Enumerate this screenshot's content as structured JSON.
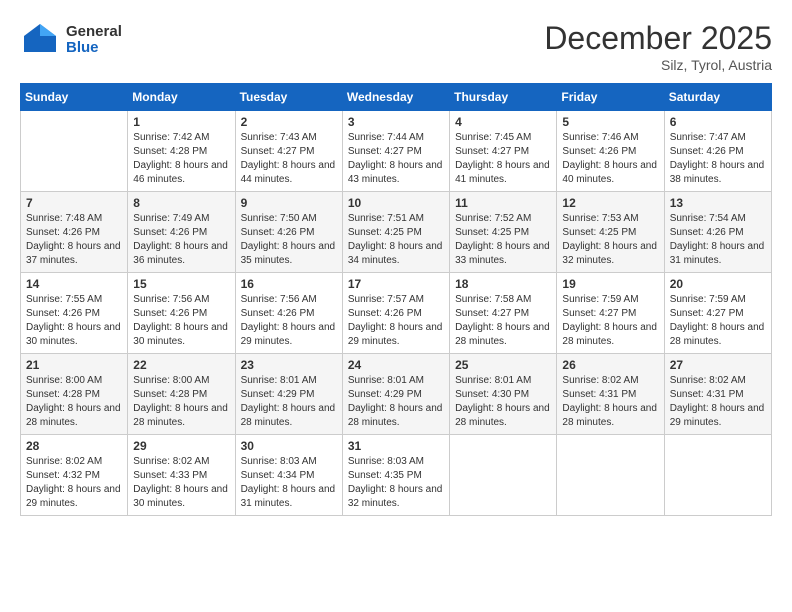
{
  "header": {
    "logo_general": "General",
    "logo_blue": "Blue",
    "month": "December 2025",
    "location": "Silz, Tyrol, Austria"
  },
  "weekdays": [
    "Sunday",
    "Monday",
    "Tuesday",
    "Wednesday",
    "Thursday",
    "Friday",
    "Saturday"
  ],
  "weeks": [
    [
      {
        "day": "",
        "sunrise": "",
        "sunset": "",
        "daylight": ""
      },
      {
        "day": "1",
        "sunrise": "Sunrise: 7:42 AM",
        "sunset": "Sunset: 4:28 PM",
        "daylight": "Daylight: 8 hours and 46 minutes."
      },
      {
        "day": "2",
        "sunrise": "Sunrise: 7:43 AM",
        "sunset": "Sunset: 4:27 PM",
        "daylight": "Daylight: 8 hours and 44 minutes."
      },
      {
        "day": "3",
        "sunrise": "Sunrise: 7:44 AM",
        "sunset": "Sunset: 4:27 PM",
        "daylight": "Daylight: 8 hours and 43 minutes."
      },
      {
        "day": "4",
        "sunrise": "Sunrise: 7:45 AM",
        "sunset": "Sunset: 4:27 PM",
        "daylight": "Daylight: 8 hours and 41 minutes."
      },
      {
        "day": "5",
        "sunrise": "Sunrise: 7:46 AM",
        "sunset": "Sunset: 4:26 PM",
        "daylight": "Daylight: 8 hours and 40 minutes."
      },
      {
        "day": "6",
        "sunrise": "Sunrise: 7:47 AM",
        "sunset": "Sunset: 4:26 PM",
        "daylight": "Daylight: 8 hours and 38 minutes."
      }
    ],
    [
      {
        "day": "7",
        "sunrise": "Sunrise: 7:48 AM",
        "sunset": "Sunset: 4:26 PM",
        "daylight": "Daylight: 8 hours and 37 minutes."
      },
      {
        "day": "8",
        "sunrise": "Sunrise: 7:49 AM",
        "sunset": "Sunset: 4:26 PM",
        "daylight": "Daylight: 8 hours and 36 minutes."
      },
      {
        "day": "9",
        "sunrise": "Sunrise: 7:50 AM",
        "sunset": "Sunset: 4:26 PM",
        "daylight": "Daylight: 8 hours and 35 minutes."
      },
      {
        "day": "10",
        "sunrise": "Sunrise: 7:51 AM",
        "sunset": "Sunset: 4:25 PM",
        "daylight": "Daylight: 8 hours and 34 minutes."
      },
      {
        "day": "11",
        "sunrise": "Sunrise: 7:52 AM",
        "sunset": "Sunset: 4:25 PM",
        "daylight": "Daylight: 8 hours and 33 minutes."
      },
      {
        "day": "12",
        "sunrise": "Sunrise: 7:53 AM",
        "sunset": "Sunset: 4:25 PM",
        "daylight": "Daylight: 8 hours and 32 minutes."
      },
      {
        "day": "13",
        "sunrise": "Sunrise: 7:54 AM",
        "sunset": "Sunset: 4:26 PM",
        "daylight": "Daylight: 8 hours and 31 minutes."
      }
    ],
    [
      {
        "day": "14",
        "sunrise": "Sunrise: 7:55 AM",
        "sunset": "Sunset: 4:26 PM",
        "daylight": "Daylight: 8 hours and 30 minutes."
      },
      {
        "day": "15",
        "sunrise": "Sunrise: 7:56 AM",
        "sunset": "Sunset: 4:26 PM",
        "daylight": "Daylight: 8 hours and 30 minutes."
      },
      {
        "day": "16",
        "sunrise": "Sunrise: 7:56 AM",
        "sunset": "Sunset: 4:26 PM",
        "daylight": "Daylight: 8 hours and 29 minutes."
      },
      {
        "day": "17",
        "sunrise": "Sunrise: 7:57 AM",
        "sunset": "Sunset: 4:26 PM",
        "daylight": "Daylight: 8 hours and 29 minutes."
      },
      {
        "day": "18",
        "sunrise": "Sunrise: 7:58 AM",
        "sunset": "Sunset: 4:27 PM",
        "daylight": "Daylight: 8 hours and 28 minutes."
      },
      {
        "day": "19",
        "sunrise": "Sunrise: 7:59 AM",
        "sunset": "Sunset: 4:27 PM",
        "daylight": "Daylight: 8 hours and 28 minutes."
      },
      {
        "day": "20",
        "sunrise": "Sunrise: 7:59 AM",
        "sunset": "Sunset: 4:27 PM",
        "daylight": "Daylight: 8 hours and 28 minutes."
      }
    ],
    [
      {
        "day": "21",
        "sunrise": "Sunrise: 8:00 AM",
        "sunset": "Sunset: 4:28 PM",
        "daylight": "Daylight: 8 hours and 28 minutes."
      },
      {
        "day": "22",
        "sunrise": "Sunrise: 8:00 AM",
        "sunset": "Sunset: 4:28 PM",
        "daylight": "Daylight: 8 hours and 28 minutes."
      },
      {
        "day": "23",
        "sunrise": "Sunrise: 8:01 AM",
        "sunset": "Sunset: 4:29 PM",
        "daylight": "Daylight: 8 hours and 28 minutes."
      },
      {
        "day": "24",
        "sunrise": "Sunrise: 8:01 AM",
        "sunset": "Sunset: 4:29 PM",
        "daylight": "Daylight: 8 hours and 28 minutes."
      },
      {
        "day": "25",
        "sunrise": "Sunrise: 8:01 AM",
        "sunset": "Sunset: 4:30 PM",
        "daylight": "Daylight: 8 hours and 28 minutes."
      },
      {
        "day": "26",
        "sunrise": "Sunrise: 8:02 AM",
        "sunset": "Sunset: 4:31 PM",
        "daylight": "Daylight: 8 hours and 28 minutes."
      },
      {
        "day": "27",
        "sunrise": "Sunrise: 8:02 AM",
        "sunset": "Sunset: 4:31 PM",
        "daylight": "Daylight: 8 hours and 29 minutes."
      }
    ],
    [
      {
        "day": "28",
        "sunrise": "Sunrise: 8:02 AM",
        "sunset": "Sunset: 4:32 PM",
        "daylight": "Daylight: 8 hours and 29 minutes."
      },
      {
        "day": "29",
        "sunrise": "Sunrise: 8:02 AM",
        "sunset": "Sunset: 4:33 PM",
        "daylight": "Daylight: 8 hours and 30 minutes."
      },
      {
        "day": "30",
        "sunrise": "Sunrise: 8:03 AM",
        "sunset": "Sunset: 4:34 PM",
        "daylight": "Daylight: 8 hours and 31 minutes."
      },
      {
        "day": "31",
        "sunrise": "Sunrise: 8:03 AM",
        "sunset": "Sunset: 4:35 PM",
        "daylight": "Daylight: 8 hours and 32 minutes."
      },
      {
        "day": "",
        "sunrise": "",
        "sunset": "",
        "daylight": ""
      },
      {
        "day": "",
        "sunrise": "",
        "sunset": "",
        "daylight": ""
      },
      {
        "day": "",
        "sunrise": "",
        "sunset": "",
        "daylight": ""
      }
    ]
  ]
}
